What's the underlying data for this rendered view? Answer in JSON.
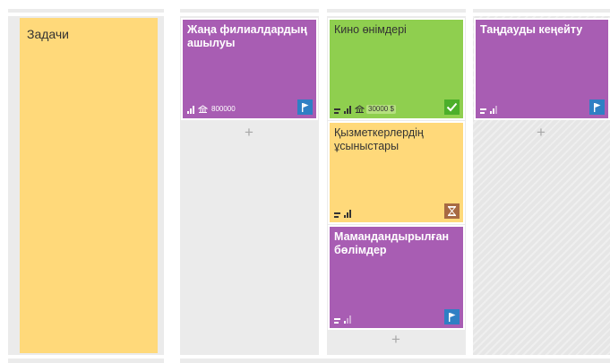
{
  "colors": {
    "yellow": "#ffd97a",
    "purple": "#a85db3",
    "green": "#8fcf4f",
    "column_bg": "#ebebeb",
    "status_blue": "#2f7fc4",
    "status_green": "#4caf2a",
    "status_brown": "#a86a43"
  },
  "columns": [
    {
      "cards": [
        {
          "title": "Задачи"
        }
      ]
    },
    {
      "cards": [
        {
          "title": "Жаңа филиалдардың ашылуы",
          "money": "800000",
          "status": "flag-icon"
        }
      ],
      "add_label": "+"
    },
    {
      "cards": [
        {
          "title": "Кино өнімдері",
          "money": "30000 $",
          "status": "check-icon"
        },
        {
          "title": "Қызметкерлердің ұсыныстары",
          "status": "hourglass-icon"
        },
        {
          "title": "Мамандандырылған бөлімдер",
          "status": "flag-icon"
        }
      ],
      "add_label": "+"
    },
    {
      "cards": [
        {
          "title": "Таңдауды кеңейту",
          "status": "flag-icon"
        }
      ],
      "add_label": "+"
    }
  ]
}
